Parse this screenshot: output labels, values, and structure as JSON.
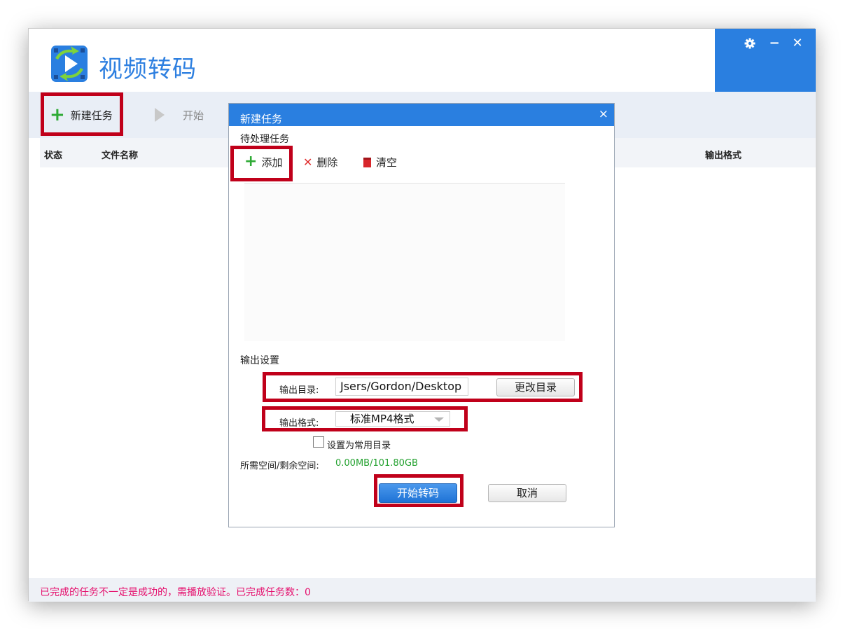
{
  "app": {
    "title": "视频转码",
    "controls": {
      "settings_icon": "gear-icon",
      "minimize_label": "−",
      "close_label": "✕"
    }
  },
  "toolbar": {
    "new_task_label": "新建任务",
    "start_label": "开始"
  },
  "list": {
    "columns": [
      "状态",
      "文件名称",
      "输出格式"
    ]
  },
  "status_bar": {
    "text": "已完成的任务不一定是成功的，需播放验证。已完成任务数：0"
  },
  "dialog": {
    "title": "新建任务",
    "close_label": "×",
    "pending_section": "待处理任务",
    "add_label": "添加",
    "delete_label": "删除",
    "clear_label": "清空",
    "output_section": "输出设置",
    "output_dir_label": "输出目录:",
    "output_dir_value": "Jsers/Gordon/Desktop",
    "change_dir_label": "更改目录",
    "output_format_label": "输出格式:",
    "output_format_value": "标准MP4格式",
    "set_default_label": "设置为常用目录",
    "space_label": "所需空间/剩余空间:",
    "space_value": "0.00MB/101.80GB",
    "start_button_label": "开始转码",
    "cancel_button_label": "取消"
  },
  "colors": {
    "accent": "#2a7fe0",
    "highlight": "#c0001a",
    "success": "#23a12f",
    "warning_text": "#e5106d"
  }
}
